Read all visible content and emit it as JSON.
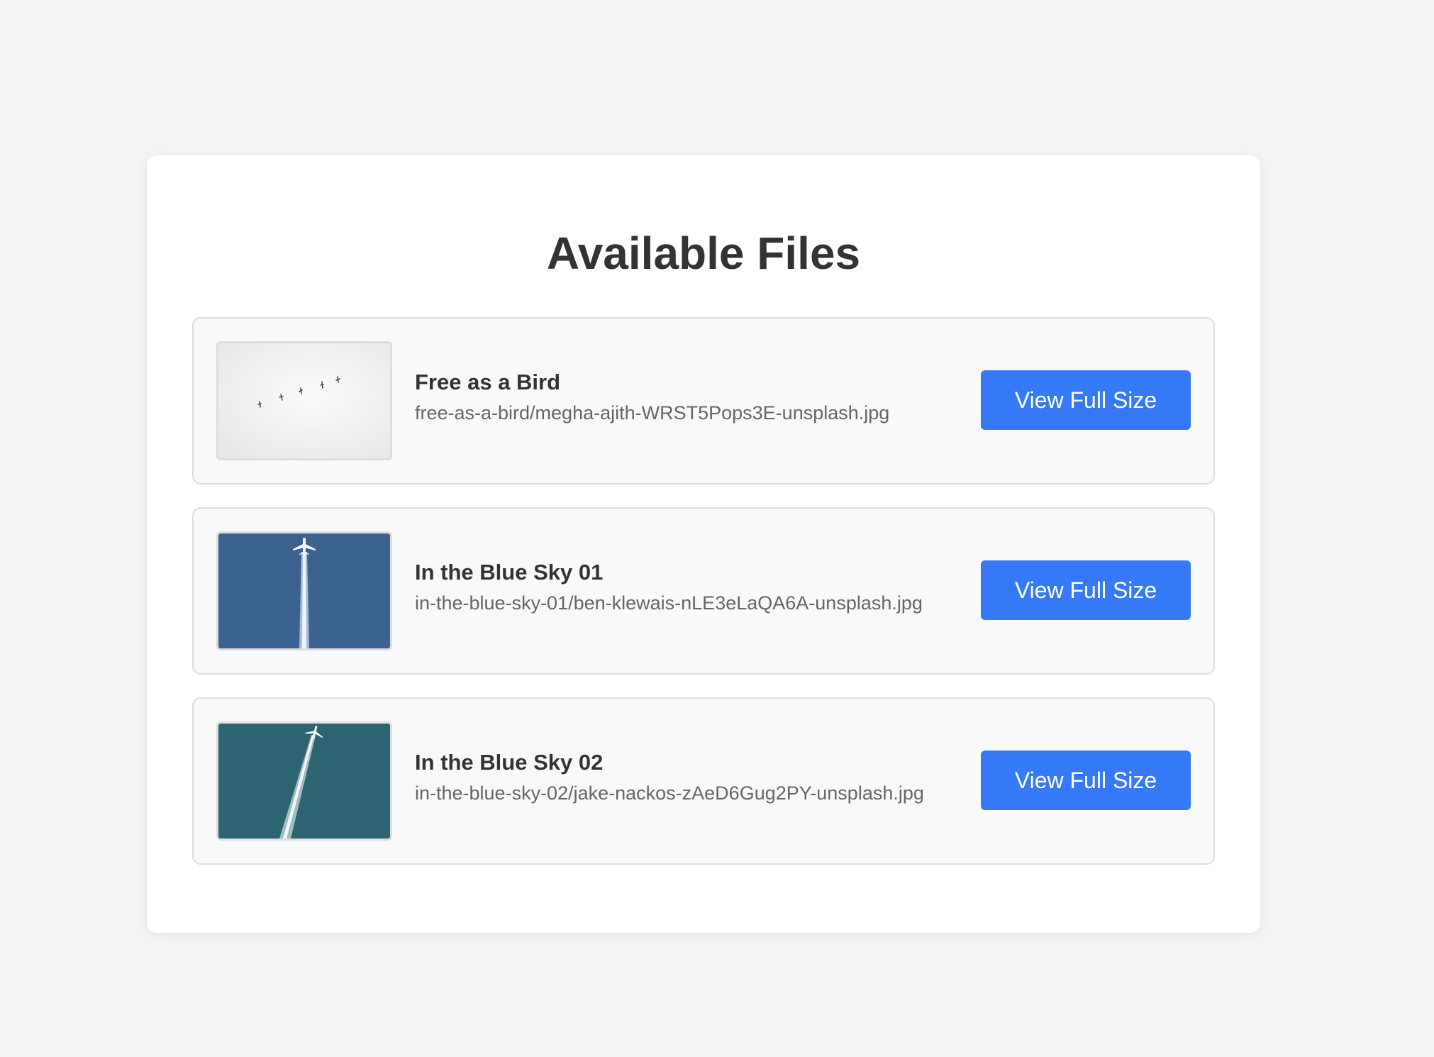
{
  "page": {
    "title": "Available Files"
  },
  "files": [
    {
      "title": "Free as a Bird",
      "path": "free-as-a-bird/megha-ajith-WRST5Pops3E-unsplash.jpg",
      "button_label": "View Full Size",
      "thumbnail": "birds-in-white-sky-thumbnail"
    },
    {
      "title": "In the Blue Sky 01",
      "path": "in-the-blue-sky-01/ben-klewais-nLE3eLaQA6A-unsplash.jpg",
      "button_label": "View Full Size",
      "thumbnail": "airplane-contrail-blue-sky-thumbnail"
    },
    {
      "title": "In the Blue Sky 02",
      "path": "in-the-blue-sky-02/jake-nackos-zAeD6Gug2PY-unsplash.jpg",
      "button_label": "View Full Size",
      "thumbnail": "airplane-contrail-teal-sky-thumbnail"
    }
  ],
  "colors": {
    "background": "#f4f4f4",
    "card": "#ffffff",
    "item_background": "#f9f9f9",
    "item_border": "#dddddd",
    "button": "#3579f6",
    "title_text": "#333333",
    "path_text": "#666666"
  }
}
